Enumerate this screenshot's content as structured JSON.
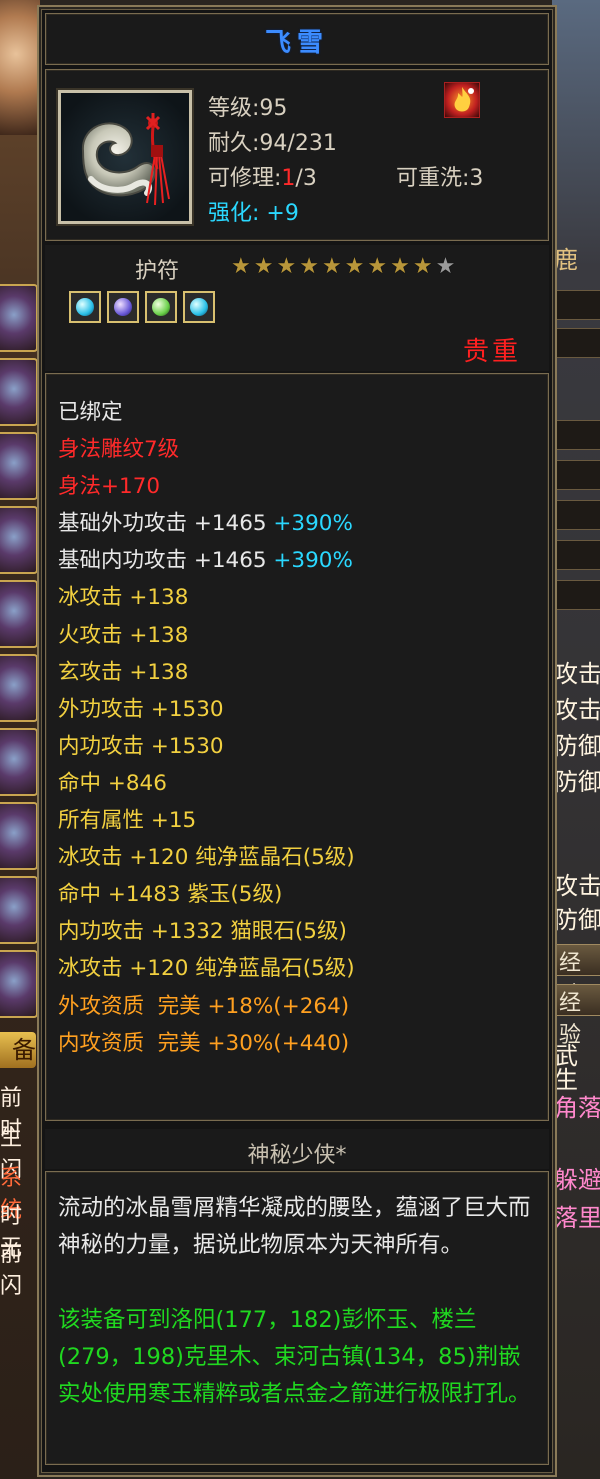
{
  "background": {
    "left_texts": [
      "备",
      "前时",
      "生闪",
      "系统",
      "时无",
      "前闪"
    ],
    "right_texts": [
      "鹿",
      "攻击",
      "攻击",
      "防御",
      "防御",
      "攻击",
      "防御",
      "经验",
      "经验",
      "武",
      "生",
      "角落",
      "躲避",
      "落里"
    ]
  },
  "item": {
    "name": "飞雪",
    "level_label": "等级:",
    "level_value": "95",
    "durability_label": "耐久:",
    "durability_value": "94/231",
    "repair_label": "可修理:",
    "repair_used": "1",
    "repair_total": "/3",
    "rewash_label": "可重洗:",
    "rewash_value": "3",
    "enhance_label": "强化:",
    "enhance_value": "+9",
    "type": "护符",
    "stars_filled": 9,
    "stars_total": 10,
    "rarity": "贵重",
    "icon": "jade-pendant-icon"
  },
  "attributes": [
    {
      "text": "已绑定",
      "color": "white"
    },
    {
      "text": "身法雕纹7级",
      "color": "red"
    },
    {
      "text": "身法+170",
      "color": "red"
    },
    {
      "text": "基础外功攻击 +1465 ",
      "color": "white",
      "extra": "+390%"
    },
    {
      "text": "基础内功攻击 +1465 ",
      "color": "white",
      "extra": "+390%"
    },
    {
      "text": "冰攻击 +138",
      "color": "yellow"
    },
    {
      "text": "火攻击 +138",
      "color": "yellow"
    },
    {
      "text": "玄攻击 +138",
      "color": "yellow"
    },
    {
      "text": "外功攻击 +1530",
      "color": "yellow"
    },
    {
      "text": "内功攻击 +1530",
      "color": "yellow"
    },
    {
      "text": "命中 +846",
      "color": "yellow"
    },
    {
      "text": "所有属性 +15",
      "color": "yellow"
    },
    {
      "text": "冰攻击 +120 纯净蓝晶石(5级)",
      "color": "yellow"
    },
    {
      "text": "命中 +1483 紫玉(5级)",
      "color": "yellow"
    },
    {
      "text": "内功攻击 +1332 猫眼石(5级)",
      "color": "yellow"
    },
    {
      "text": "冰攻击 +120 纯净蓝晶石(5级)",
      "color": "yellow"
    },
    {
      "text": "外攻资质  完美 +18%(+264)",
      "color": "orange"
    },
    {
      "text": "内攻资质  完美 +30%(+440)",
      "color": "orange"
    }
  ],
  "owner": "神秘少侠*",
  "description": "流动的冰晶雪屑精华凝成的腰坠，蕴涵了巨大而神秘的力量，据说此物原本为天神所有。",
  "hint": "该装备可到洛阳(177，182)彭怀玉、楼兰(279，198)克里木、束河古镇(134，85)荆嵌实处使用寒玉精粹或者点金之箭进行极限打孔。"
}
